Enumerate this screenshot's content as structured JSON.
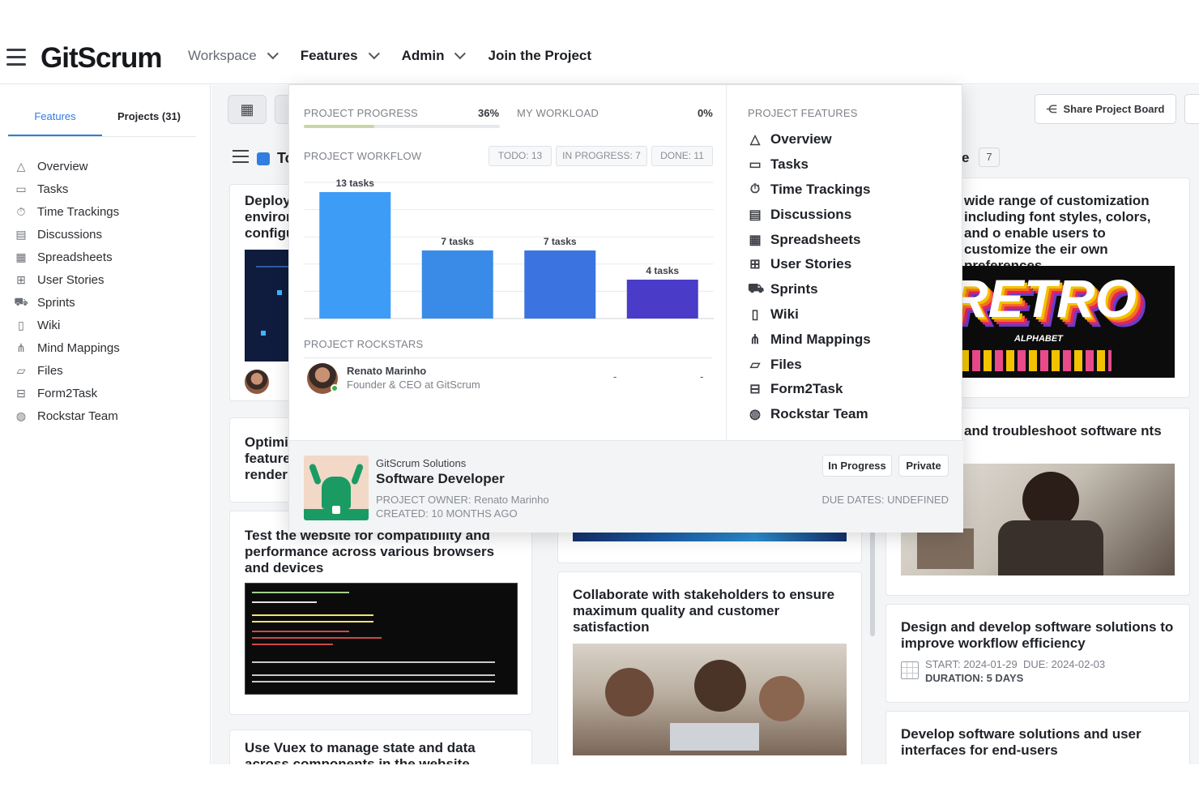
{
  "header": {
    "logo": "GitScrum",
    "nav": [
      {
        "label": "Workspace",
        "muted": true,
        "has_caret": true
      },
      {
        "label": "Features",
        "muted": false,
        "has_caret": true
      },
      {
        "label": "Admin",
        "muted": false,
        "has_caret": true
      },
      {
        "label": "Join the Project",
        "muted": false,
        "has_caret": false
      }
    ]
  },
  "sidebar": {
    "tabs": [
      {
        "label": "Features",
        "active": true
      },
      {
        "label": "Projects (31)",
        "active": false
      }
    ],
    "items": [
      {
        "label": "Overview",
        "icon": "triangle-icon"
      },
      {
        "label": "Tasks",
        "icon": "window-icon"
      },
      {
        "label": "Time Trackings",
        "icon": "stopwatch-icon"
      },
      {
        "label": "Discussions",
        "icon": "chat-icon"
      },
      {
        "label": "Spreadsheets",
        "icon": "spreadsheet-icon"
      },
      {
        "label": "User Stories",
        "icon": "story-icon"
      },
      {
        "label": "Sprints",
        "icon": "truck-icon"
      },
      {
        "label": "Wiki",
        "icon": "book-icon"
      },
      {
        "label": "Mind Mappings",
        "icon": "hierarchy-icon"
      },
      {
        "label": "Files",
        "icon": "folder-icon"
      },
      {
        "label": "Form2Task",
        "icon": "form-icon"
      },
      {
        "label": "Rockstar Team",
        "icon": "palette-icon"
      }
    ]
  },
  "board": {
    "share_label": "Share Project Board",
    "column_title_partial": "To",
    "column_right_title_partial": "e",
    "column_right_count": "7",
    "cards": {
      "c1_title": "Deploy environ configu",
      "c2_title": "Optimi feature renderi",
      "c3_title": "Test the website for compatibility and performance across various browsers and devices",
      "c4_title": "Use Vuex to manage state and data across components in the website",
      "c5_title": "Collaborate with stakeholders to ensure maximum quality and customer satisfaction",
      "c6_title": "wide range of customization including font styles, colors, and o enable users to customize the eir own preferences",
      "c7_title": "and troubleshoot software nts",
      "c8_title": "Design and develop software solutions to improve workflow efficiency",
      "c8_start": "START: 2024-01-29",
      "c8_due": "DUE: 2024-02-03",
      "c8_duration": "DURATION: 5 DAYS",
      "c9_title": "Develop software solutions and user interfaces for end-users",
      "retro_big": "RETRO",
      "retro_small": "ALPHABET"
    }
  },
  "panel": {
    "progress_label": "PROJECT PROGRESS",
    "progress_value": "36%",
    "progress_fraction": 0.36,
    "workload_label": "MY WORKLOAD",
    "workload_value": "0%",
    "workflow_label": "PROJECT WORKFLOW",
    "badges": [
      "TODO: 13",
      "IN PROGRESS: 7",
      "DONE: 11"
    ],
    "rockstars_label": "PROJECT ROCKSTARS",
    "rockstar": {
      "name": "Renato Marinho",
      "role": "Founder & CEO at GitScrum",
      "col1": "-",
      "col2": "-"
    },
    "features_label": "PROJECT FEATURES",
    "features": [
      {
        "label": "Overview",
        "icon": "triangle-icon"
      },
      {
        "label": "Tasks",
        "icon": "window-icon"
      },
      {
        "label": "Time Trackings",
        "icon": "stopwatch-icon"
      },
      {
        "label": "Discussions",
        "icon": "chat-icon"
      },
      {
        "label": "Spreadsheets",
        "icon": "spreadsheet-icon"
      },
      {
        "label": "User Stories",
        "icon": "story-icon"
      },
      {
        "label": "Sprints",
        "icon": "truck-icon"
      },
      {
        "label": "Wiki",
        "icon": "book-icon"
      },
      {
        "label": "Mind Mappings",
        "icon": "hierarchy-icon"
      },
      {
        "label": "Files",
        "icon": "folder-icon"
      },
      {
        "label": "Form2Task",
        "icon": "form-icon"
      },
      {
        "label": "Rockstar Team",
        "icon": "palette-icon"
      }
    ],
    "project": {
      "company": "GitScrum Solutions",
      "title": "Software Developer",
      "owner": "PROJECT OWNER: Renato Marinho",
      "created": "CREATED: 10 MONTHS AGO",
      "due": "DUE DATES: UNDEFINED",
      "status": "In Progress",
      "visibility": "Private"
    }
  },
  "chart_data": {
    "type": "bar",
    "categories": [
      "",
      "",
      "",
      ""
    ],
    "values": [
      13,
      7,
      7,
      4
    ],
    "data_labels": [
      "13 tasks",
      "7 tasks",
      "7 tasks",
      "4 tasks"
    ],
    "colors": [
      "#3d9cf5",
      "#3a8ae8",
      "#3b74e0",
      "#4a3cc9"
    ],
    "ylim": [
      0,
      14
    ],
    "grid": true
  },
  "colors": {
    "accent": "#2f7ee0",
    "online": "#3cb14a",
    "progress_fill": "#c8d7a3"
  }
}
